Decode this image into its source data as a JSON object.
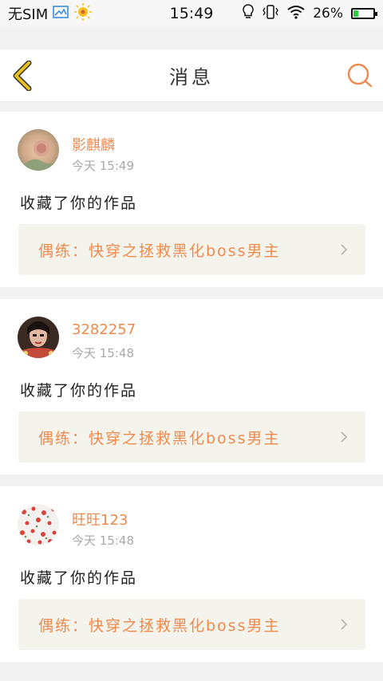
{
  "status_bar": {
    "carrier": "无SIM",
    "time": "15:49",
    "battery_percent": "26%",
    "battery_level": 0.26
  },
  "header": {
    "title": "消息"
  },
  "messages": [
    {
      "username": "影麒麟",
      "time": "今天 15:49",
      "action": "收藏了你的作品",
      "work": "偶练：快穿之拯救黑化boss男主"
    },
    {
      "username": "3282257",
      "time": "今天 15:48",
      "action": "收藏了你的作品",
      "work": "偶练：快穿之拯救黑化boss男主"
    },
    {
      "username": "旺旺123",
      "time": "今天 15:48",
      "action": "收藏了你的作品",
      "work": "偶练：快穿之拯救黑化boss男主"
    }
  ],
  "colors": {
    "accent": "#ef8a4e",
    "back_arrow": "#e8c21a",
    "card_link_bg": "#f5f4ec"
  },
  "icons": [
    "back-arrow-icon",
    "search-icon",
    "chevron-right-icon",
    "signal-icon",
    "weather-icon",
    "bulb-icon",
    "vibrate-icon",
    "wifi-icon",
    "battery-icon"
  ]
}
